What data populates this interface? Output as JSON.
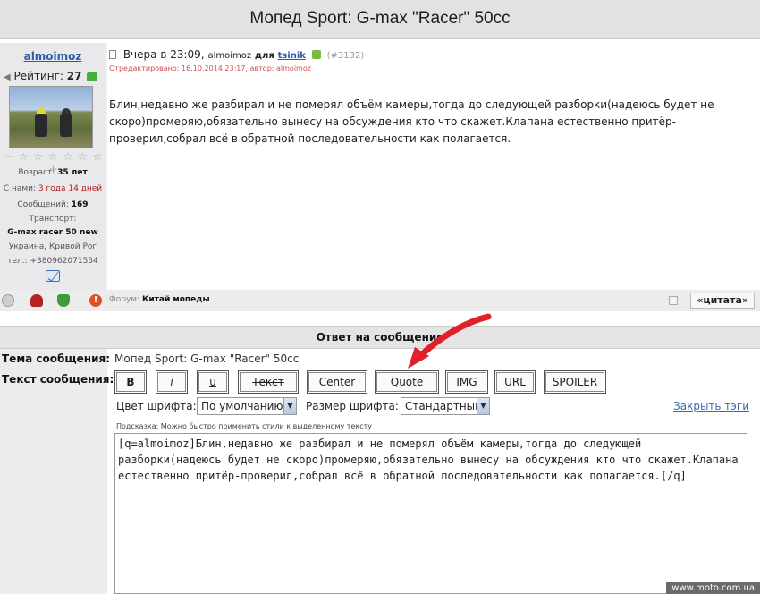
{
  "page": {
    "title": "Мопед Sport: G-max \"Racer\" 50cc"
  },
  "user": {
    "name": "almoimoz",
    "rating_label": "Рейтинг:",
    "rating_value": "27",
    "stars": "− ☆ ☆ ☆ ☆ ☆ ☆ +",
    "age_label": "Возраст:",
    "age_value": "35 лет",
    "since_label": "С нами:",
    "since_value": "3 года 14 дней",
    "posts_label": "Сообщений:",
    "posts_value": "169",
    "transport_label": "Транспорт:",
    "transport_value": "G-max racer 50 new",
    "location": "Украина, Кривой Рог",
    "phone": "тел.: +380962071554"
  },
  "post": {
    "time": "Вчера в 23:09,",
    "author": "almoimoz",
    "for_label": "для",
    "to": "tsinik",
    "number": "(#3132)",
    "edited": "Отредактировано: 16.10.2014 23:17, автор:",
    "edited_author": "almoimoz",
    "text": "Блин,недавно же разбирал и не померял объём камеры,тогда до следующей разборки(надеюсь будет не скоро)промеряю,обязательно вынесу на обсуждения кто что скажет.Клапана естественно притёр-проверил,собрал всё в обратной последовательности как полагается.",
    "forum_label": "Форум:",
    "forum_name": "Китай мопеды",
    "quote_button": "«цитата»",
    "warn_glyph": "!"
  },
  "reply": {
    "heading": "Ответ на сообщение",
    "subject_label": "Тема сообщения:",
    "subject_value": "Мопед Sport: G-max \"Racer\" 50cc",
    "text_label": "Текст сообщения:",
    "buttons": {
      "bold": "B",
      "italic": "i",
      "underline": "u",
      "strike": "Текст",
      "center": "Center",
      "quote": "Quote",
      "img": "IMG",
      "url": "URL",
      "spoiler": "SPOILER"
    },
    "font_color_label": "Цвет шрифта:",
    "font_color_value": "По умолчанию",
    "font_size_label": "Размер шрифта:",
    "font_size_value": "Стандартный",
    "close_tags": "Закрыть тэги",
    "hint": "Подсказка: Можно быстро применить стили к выделенному тексту",
    "textarea_value": "[q=almoimoz]Блин,недавно же разбирал и не померял объём камеры,тогда до следующей разборки(надеюсь будет не скоро)промеряю,обязательно вынесу на обсуждения кто что скажет.Клапана естественно притёр-проверил,собрал всё в обратной последовательности как полагается.[/q]"
  },
  "watermark": "www.moto.com.ua",
  "icons": [
    "doc-icon",
    "thumb-icon",
    "mail-icon",
    "info-icon",
    "dislike-icon",
    "like-icon",
    "warning-icon",
    "dropdown-arrow-icon",
    "red-arrow-annotation"
  ],
  "colors": {
    "link": "#2e5da8",
    "edited": "#d05050",
    "arrow": "#e0202a"
  }
}
